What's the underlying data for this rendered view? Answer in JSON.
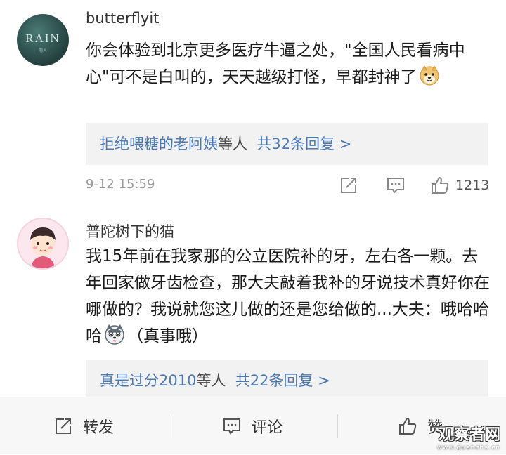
{
  "comments": [
    {
      "username": "butterflyit",
      "avatar_text": "RAIN",
      "avatar_subtext": "雨人",
      "text_before": "你会体验到北京更多医疗牛逼之处，\"全国人民看病中心\"可不是白叫的，天天越级打怪，早都封神了",
      "emoji": "doge-emoji",
      "reply_user": "拒绝喂糖的老阿姨",
      "reply_mid": "等人",
      "reply_count": "共32条回复 >",
      "timestamp": "9-12 15:59",
      "likes": "1213"
    },
    {
      "username": "普陀树下的猫",
      "text_before": "我15年前在我家那的公立医院补的牙，左右各一颗。去年回家做牙齿检查，那大夫敲着我补的牙说技术真好你在哪做的？我说就您这儿做的还是您给做的...大夫：哦哈哈哈",
      "emoji": "husky-emoji",
      "text_after": "（真事哦）",
      "reply_user": "真是过分2010",
      "reply_mid": "等人",
      "reply_count": "共22条回复 >"
    }
  ],
  "bottom_bar": {
    "share_label": "转发",
    "comment_label": "评论",
    "like_label": "赞"
  },
  "watermark": {
    "main": "观察者网",
    "sub": "www.guancha.cn"
  },
  "colors": {
    "link": "#4a79b4",
    "reply_bg": "#f2f2f2",
    "meta": "#999999"
  }
}
